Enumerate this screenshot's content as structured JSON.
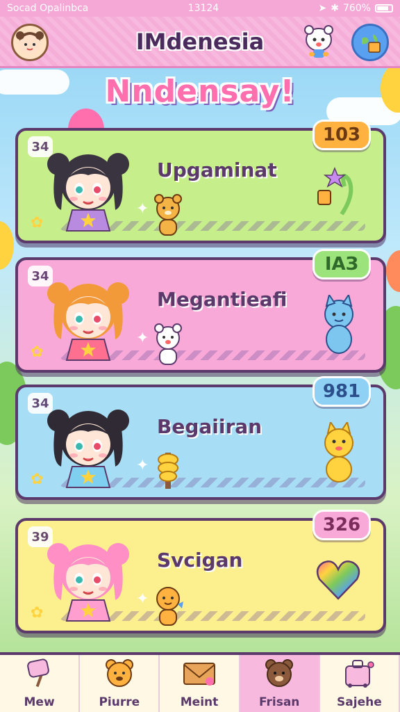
{
  "status_bar": {
    "carrier": "Socad Opalinbca",
    "time": "13124",
    "battery": "760%"
  },
  "header": {
    "title": "IMdenesia"
  },
  "banner": {
    "text": "Nndensay!"
  },
  "cards": [
    {
      "rank": "34",
      "label": "Upgaminat",
      "score": "103",
      "bg": "#c6ee8a",
      "score_bg": "#ffb23f",
      "score_color": "#6b3a12"
    },
    {
      "rank": "34",
      "label": "Megantieafi",
      "score": "IAЗ",
      "bg": "#f9a9d8",
      "score_bg": "#9be37a",
      "score_color": "#2f6a2a"
    },
    {
      "rank": "34",
      "label": "Begaiiran",
      "score": "981",
      "bg": "#a8def5",
      "score_bg": "#8fd0f5",
      "score_color": "#2b4f8a"
    },
    {
      "rank": "39",
      "label": "Svcigan",
      "score": "326",
      "bg": "#fcef8e",
      "score_bg": "#f9a9d8",
      "score_color": "#7a2c5a"
    }
  ],
  "nav": [
    {
      "label": "Mew",
      "icon": "lollipop-icon"
    },
    {
      "label": "Piurre",
      "icon": "bear-face-icon"
    },
    {
      "label": "Meint",
      "icon": "envelope-icon"
    },
    {
      "label": "Frisan",
      "icon": "bear-brown-icon"
    },
    {
      "label": "Sajehe",
      "icon": "suitcase-icon"
    }
  ],
  "active_nav_index": 3
}
